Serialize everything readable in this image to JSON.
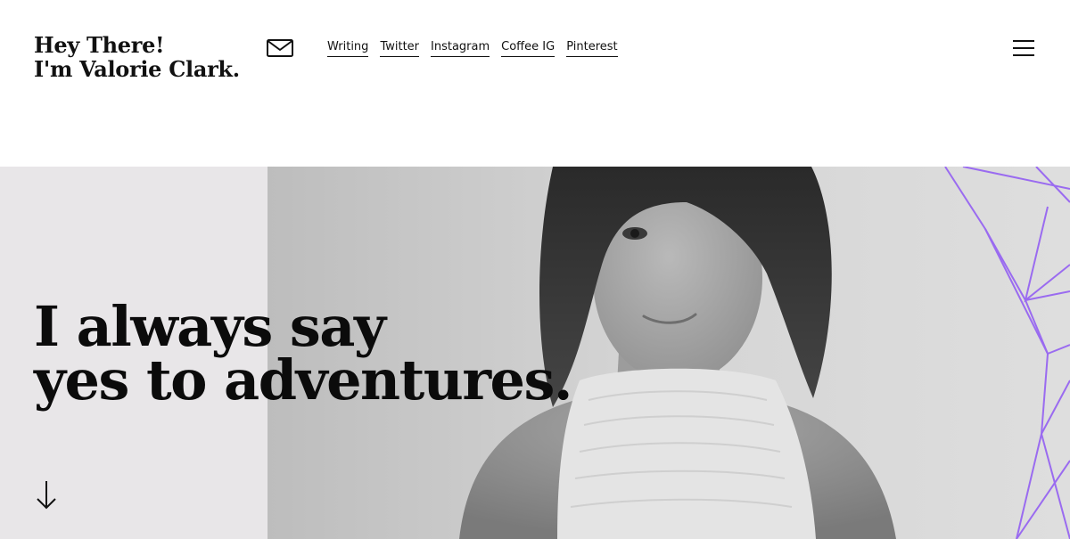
{
  "header": {
    "logo": {
      "line1": "Hey There!",
      "line2_prefix": "I'm ",
      "line2_name": "Valorie Clark",
      "line2_suffix": "."
    },
    "mail_icon": "mail-icon",
    "nav": [
      "Writing",
      "Twitter",
      "Instagram",
      "Coffee IG",
      "Pinterest"
    ],
    "menu_icon": "hamburger-menu-icon"
  },
  "hero": {
    "headline_line1": "I always say",
    "headline_line2": "yes to adventures.",
    "scroll_icon": "arrow-down-icon"
  },
  "colors": {
    "highlight": "#98f5c1",
    "accent_lines": "#9a6bf0",
    "text": "#111111",
    "hero_left_bg": "#e8e6e8"
  }
}
